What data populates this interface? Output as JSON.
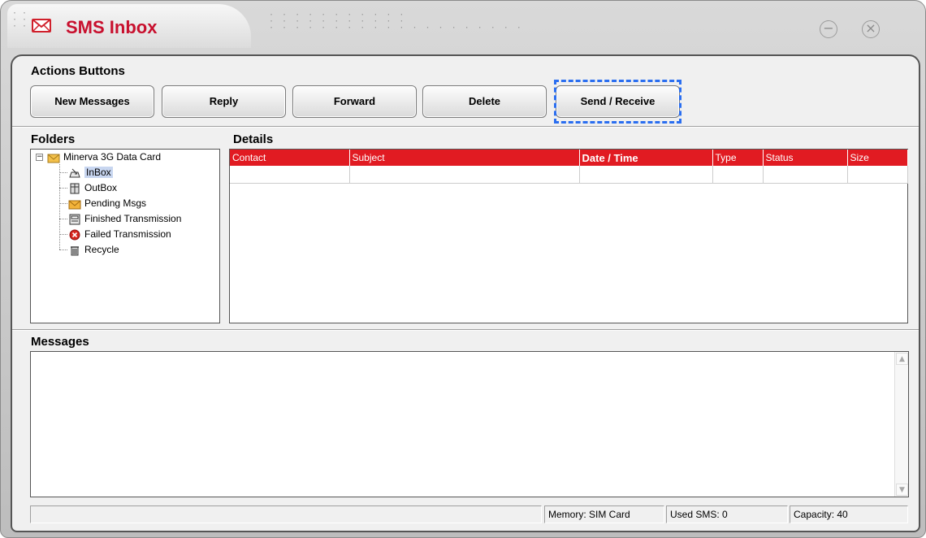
{
  "window": {
    "title": "SMS Inbox",
    "minimize_symbol": "−",
    "close_symbol": "×"
  },
  "actions": {
    "label": "Actions Buttons",
    "buttons": [
      {
        "label": "New Messages"
      },
      {
        "label": "Reply"
      },
      {
        "label": "Forward"
      },
      {
        "label": "Delete"
      },
      {
        "label": "Send / Receive"
      }
    ]
  },
  "folders": {
    "label": "Folders",
    "root": {
      "label": "Minerva 3G Data Card",
      "icon": "envelope-icon",
      "expander": "−"
    },
    "items": [
      {
        "label": "InBox",
        "icon": "inbox-tray-icon",
        "selected": true
      },
      {
        "label": "OutBox",
        "icon": "outbox-icon"
      },
      {
        "label": "Pending Msgs",
        "icon": "envelope-icon"
      },
      {
        "label": "Finished Transmission",
        "icon": "finished-tray-icon"
      },
      {
        "label": "Failed Transmission",
        "icon": "error-icon"
      },
      {
        "label": "Recycle",
        "icon": "trash-icon"
      }
    ]
  },
  "details": {
    "label": "Details",
    "columns": [
      "Contact",
      "Subject",
      "Date / Time",
      "Type",
      "Status",
      "Size"
    ],
    "rows": []
  },
  "messages": {
    "label": "Messages",
    "body": ""
  },
  "status_bar": {
    "left": "",
    "memory": "Memory: SIM Card",
    "used_sms": "Used SMS: 0",
    "capacity": "Capacity: 40"
  },
  "colors": {
    "title_red": "#c8102e",
    "header_red": "#e11b22",
    "focus_blue": "#2a6ef0",
    "selection": "#c8d6f0"
  }
}
